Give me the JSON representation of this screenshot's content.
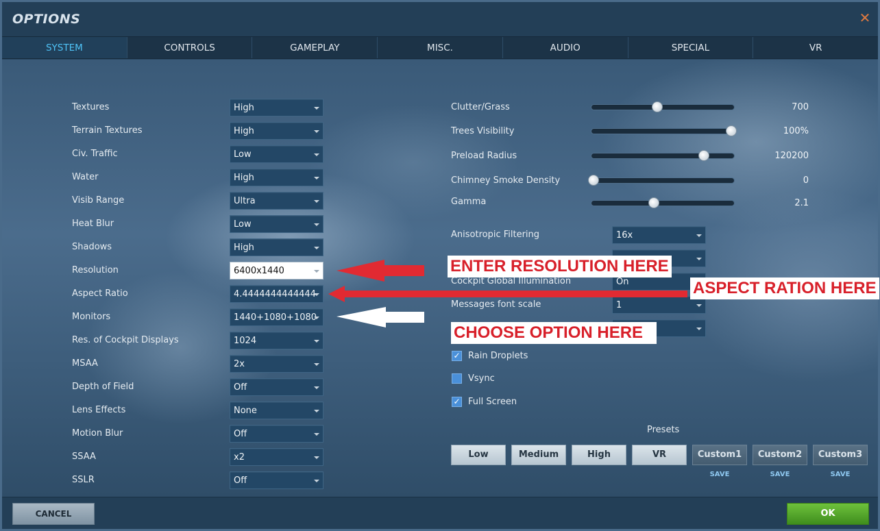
{
  "window": {
    "title": "OPTIONS"
  },
  "tabs": [
    "SYSTEM",
    "CONTROLS",
    "GAMEPLAY",
    "MISC.",
    "AUDIO",
    "SPECIAL",
    "VR"
  ],
  "left_settings": [
    {
      "label": "Textures",
      "value": "High"
    },
    {
      "label": "Terrain Textures",
      "value": "High"
    },
    {
      "label": "Civ. Traffic",
      "value": "Low"
    },
    {
      "label": "Water",
      "value": "High"
    },
    {
      "label": "Visib Range",
      "value": "Ultra"
    },
    {
      "label": "Heat Blur",
      "value": "Low"
    },
    {
      "label": "Shadows",
      "value": "High"
    },
    {
      "label": "Resolution",
      "value": "6400x1440"
    },
    {
      "label": "Aspect Ratio",
      "value": "4.4444444444444"
    },
    {
      "label": "Monitors",
      "value": "1440+1080+1080"
    },
    {
      "label": "Res. of Cockpit Displays",
      "value": "1024"
    },
    {
      "label": "MSAA",
      "value": "2x"
    },
    {
      "label": "Depth of Field",
      "value": "Off"
    },
    {
      "label": "Lens Effects",
      "value": "None"
    },
    {
      "label": "Motion Blur",
      "value": "Off"
    },
    {
      "label": "SSAA",
      "value": "x2"
    },
    {
      "label": "SSLR",
      "value": "Off"
    }
  ],
  "sliders": [
    {
      "label": "Clutter/Grass",
      "value": "700",
      "level": 0.47
    },
    {
      "label": "Trees Visibility",
      "value": "100%",
      "level": 1.0
    },
    {
      "label": "Preload Radius",
      "value": "120200",
      "level": 0.8
    },
    {
      "label": "Chimney Smoke Density",
      "value": "0",
      "level": 0.0
    },
    {
      "label": "Gamma",
      "value": "2.1",
      "level": 0.45
    }
  ],
  "right_settings": [
    {
      "label": "Anisotropic Filtering",
      "value": "16x"
    },
    {
      "label": "",
      "value": ""
    },
    {
      "label": "Cockpit Global Illumination",
      "value": "On"
    },
    {
      "label": "Messages font scale",
      "value": "1"
    },
    {
      "label": "",
      "value": ""
    }
  ],
  "checkboxes": [
    {
      "label": "Rain Droplets",
      "checked": true
    },
    {
      "label": "Vsync",
      "checked": false
    },
    {
      "label": "Full Screen",
      "checked": true
    }
  ],
  "presets": {
    "label": "Presets",
    "buttons": [
      "Low",
      "Medium",
      "High",
      "VR"
    ],
    "custom": [
      "Custom1",
      "Custom2",
      "Custom3"
    ],
    "save_label": "SAVE"
  },
  "footer": {
    "cancel": "CANCEL",
    "ok": "OK"
  },
  "annotations": {
    "resolution": "ENTER RESOLUTION HERE",
    "aspect": "ASPECT RATION HERE",
    "monitors": "CHOOSE OPTION HERE"
  },
  "colors": {
    "tab_active": "#4fc3f7",
    "close": "#e07a40",
    "ok": "#4a9a24",
    "annotation_red": "#d8202a"
  },
  "icons": {
    "close": "close-icon",
    "dropdown": "chevron-down-icon",
    "check": "checkmark-icon",
    "arrow_red": "arrow-left-icon",
    "arrow_white": "arrow-left-icon"
  }
}
